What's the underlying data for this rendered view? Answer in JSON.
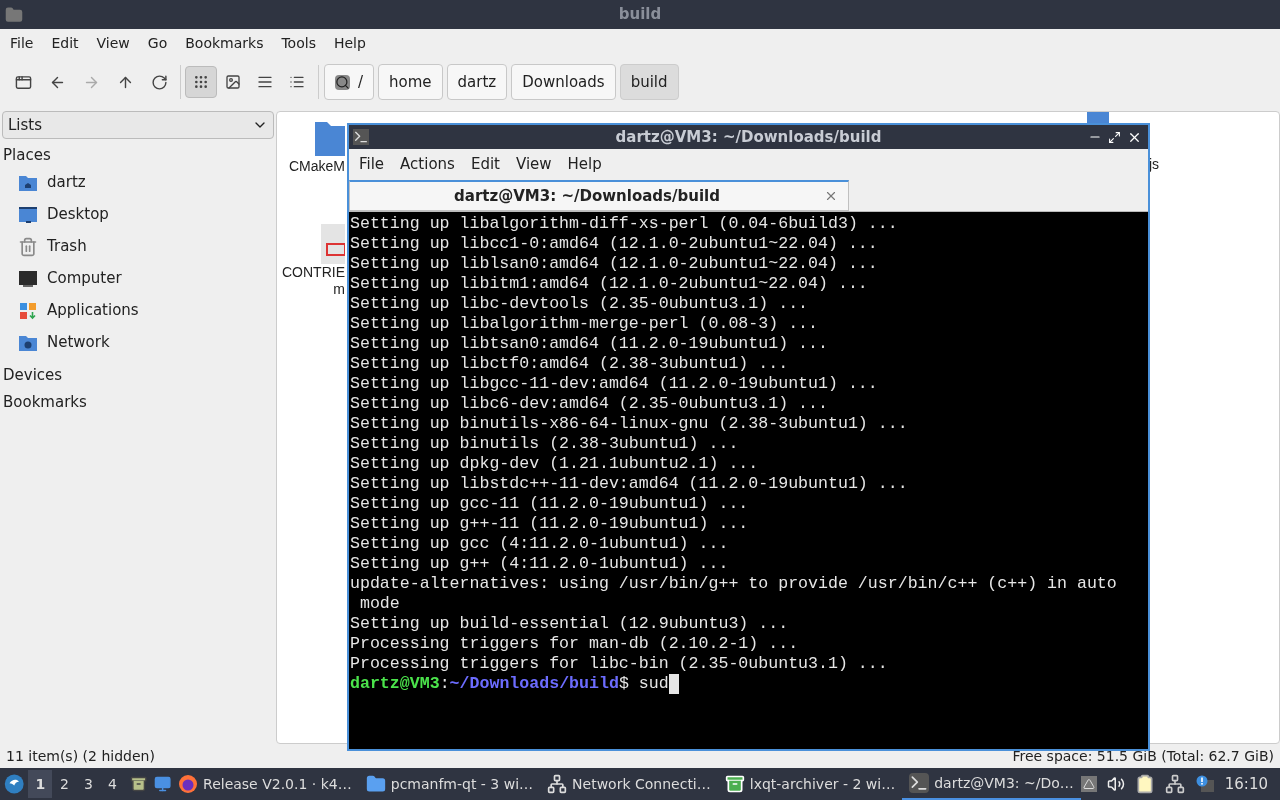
{
  "window": {
    "title": "build"
  },
  "menu": [
    "File",
    "Edit",
    "View",
    "Go",
    "Bookmarks",
    "Tools",
    "Help"
  ],
  "toolbar": {
    "nav": [
      {
        "kind": "new-window",
        "disabled": false
      },
      {
        "kind": "back",
        "disabled": false
      },
      {
        "kind": "forward",
        "disabled": true
      },
      {
        "kind": "up",
        "disabled": false
      },
      {
        "kind": "reload",
        "disabled": false
      }
    ],
    "views": [
      {
        "kind": "icons",
        "selected": true
      },
      {
        "kind": "thumbnails",
        "selected": false
      },
      {
        "kind": "compact",
        "selected": false
      },
      {
        "kind": "details",
        "selected": false
      }
    ],
    "path": [
      {
        "label": "/",
        "root": true,
        "selected": false
      },
      {
        "label": "home",
        "root": false,
        "selected": false
      },
      {
        "label": "dartz",
        "root": false,
        "selected": false
      },
      {
        "label": "Downloads",
        "root": false,
        "selected": false
      },
      {
        "label": "build",
        "root": false,
        "selected": true
      }
    ]
  },
  "sidebar": {
    "mode": "Lists",
    "sections": [
      {
        "title": "Places",
        "items": [
          {
            "kind": "home",
            "label": "dartz"
          },
          {
            "kind": "desktop",
            "label": "Desktop"
          },
          {
            "kind": "trash",
            "label": "Trash"
          },
          {
            "kind": "computer",
            "label": "Computer"
          },
          {
            "kind": "applications",
            "label": "Applications"
          },
          {
            "kind": "network",
            "label": "Network"
          }
        ]
      },
      {
        "title": "Devices"
      },
      {
        "title": "Bookmarks"
      }
    ]
  },
  "files": [
    {
      "kind": "folder",
      "lines": [
        "CMakeM"
      ]
    },
    {
      "kind": "makefile",
      "lines": [
        "CONTRIE",
        "m"
      ]
    },
    {
      "kind": "file",
      "lines": [
        "js"
      ]
    }
  ],
  "status": {
    "left": "11 item(s) (2 hidden)",
    "right": "Free space: 51.5 GiB (Total: 62.7 GiB)"
  },
  "terminal": {
    "title": "dartz@VM3: ~/Downloads/build",
    "menu": [
      "File",
      "Actions",
      "Edit",
      "View",
      "Help"
    ],
    "tab": "dartz@VM3: ~/Downloads/build",
    "lines": [
      "Setting up libalgorithm-diff-xs-perl (0.04-6build3) ...",
      "Setting up libcc1-0:amd64 (12.1.0-2ubuntu1~22.04) ...",
      "Setting up liblsan0:amd64 (12.1.0-2ubuntu1~22.04) ...",
      "Setting up libitm1:amd64 (12.1.0-2ubuntu1~22.04) ...",
      "Setting up libc-devtools (2.35-0ubuntu3.1) ...",
      "Setting up libalgorithm-merge-perl (0.08-3) ...",
      "Setting up libtsan0:amd64 (11.2.0-19ubuntu1) ...",
      "Setting up libctf0:amd64 (2.38-3ubuntu1) ...",
      "Setting up libgcc-11-dev:amd64 (11.2.0-19ubuntu1) ...",
      "Setting up libc6-dev:amd64 (2.35-0ubuntu3.1) ...",
      "Setting up binutils-x86-64-linux-gnu (2.38-3ubuntu1) ...",
      "Setting up binutils (2.38-3ubuntu1) ...",
      "Setting up dpkg-dev (1.21.1ubuntu2.1) ...",
      "Setting up libstdc++-11-dev:amd64 (11.2.0-19ubuntu1) ...",
      "Setting up gcc-11 (11.2.0-19ubuntu1) ...",
      "Setting up g++-11 (11.2.0-19ubuntu1) ...",
      "Setting up gcc (4:11.2.0-1ubuntu1) ...",
      "Setting up g++ (4:11.2.0-1ubuntu1) ...",
      "update-alternatives: using /usr/bin/g++ to provide /usr/bin/c++ (c++) in auto",
      " mode",
      "Setting up build-essential (12.9ubuntu3) ...",
      "Processing triggers for man-db (2.10.2-1) ...",
      "Processing triggers for libc-bin (2.35-0ubuntu3.1) ..."
    ],
    "prompt": {
      "user": "dartz@VM3",
      "sep": ":",
      "path": "~/Downloads/build",
      "input": "$ sud"
    }
  },
  "taskbar": {
    "desktops": [
      {
        "label": "1",
        "selected": true
      },
      {
        "label": "2",
        "selected": false
      },
      {
        "label": "3",
        "selected": false
      },
      {
        "label": "4",
        "selected": false
      }
    ],
    "tasks": [
      {
        "kind": "browser",
        "label": "Release V2.0.1 · k4…",
        "selected": false
      },
      {
        "kind": "folder",
        "label": "pcmanfm-qt - 3 wi…",
        "selected": false
      },
      {
        "kind": "network",
        "label": "Network Connecti…",
        "selected": false
      },
      {
        "kind": "archive",
        "label": "lxqt-archiver - 2 wi…",
        "selected": false
      },
      {
        "kind": "terminal",
        "label": "dartz@VM3: ~/Do…",
        "selected": true
      }
    ],
    "clock": "16:10"
  }
}
